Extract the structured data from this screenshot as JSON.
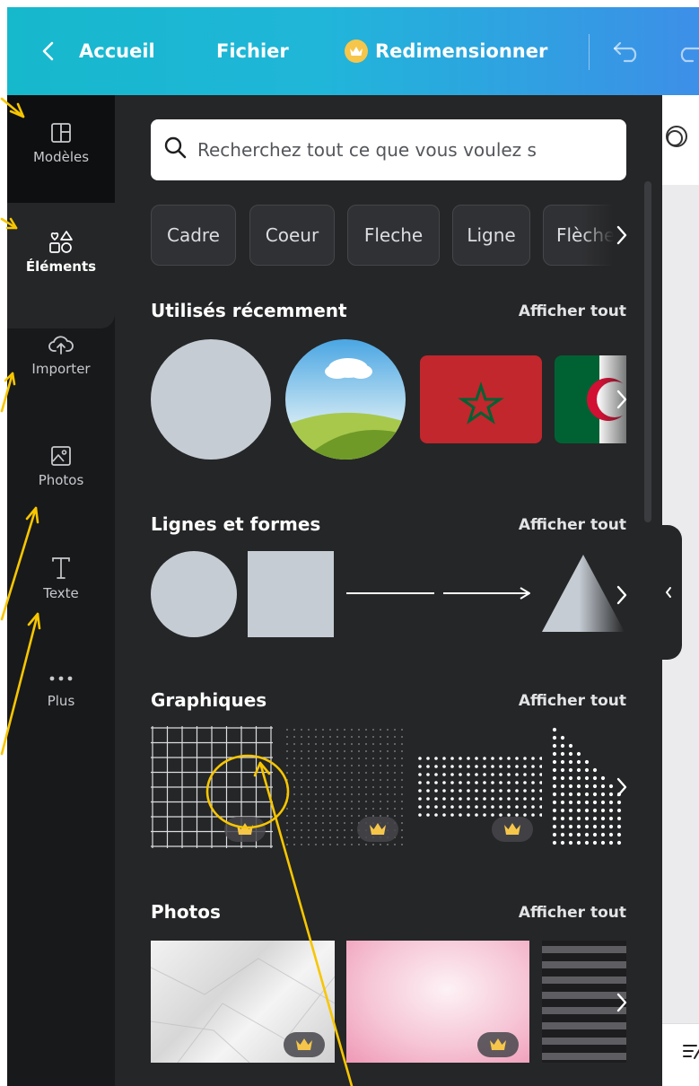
{
  "topbar": {
    "back_label": "Accueil",
    "file_label": "Fichier",
    "resize_label": "Redimensionner"
  },
  "rail": {
    "items": [
      {
        "label": "Modèles",
        "icon": "layout-icon"
      },
      {
        "label": "Éléments",
        "icon": "shapes-icon"
      },
      {
        "label": "Importer",
        "icon": "cloud-upload-icon"
      },
      {
        "label": "Photos",
        "icon": "image-icon"
      },
      {
        "label": "Texte",
        "icon": "text-icon"
      },
      {
        "label": "Plus",
        "icon": "more-dots-icon"
      }
    ]
  },
  "search": {
    "placeholder": "Recherchez tout ce que vous voulez s"
  },
  "chips": [
    "Cadre",
    "Coeur",
    "Fleche",
    "Ligne",
    "Flèche"
  ],
  "sections": {
    "recent": {
      "title": "Utilisés récemment",
      "see_all": "Afficher tout"
    },
    "shapes": {
      "title": "Lignes et formes",
      "see_all": "Afficher tout"
    },
    "graphics": {
      "title": "Graphiques",
      "see_all": "Afficher tout"
    },
    "photos": {
      "title": "Photos",
      "see_all": "Afficher tout"
    }
  },
  "colors": {
    "topbar_start": "#16b8cc",
    "topbar_end": "#3d8fe8",
    "panel": "#252627",
    "rail": "#18191b",
    "annotation": "#f7c600",
    "crown": "#f6c64a"
  }
}
